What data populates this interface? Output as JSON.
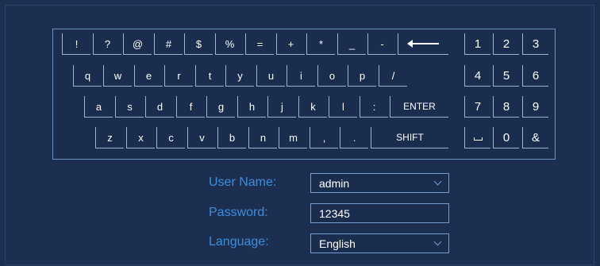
{
  "keyboard": {
    "row1": [
      "!",
      "?",
      "@",
      "#",
      "$",
      "%",
      "=",
      "+",
      "*",
      "_",
      "-"
    ],
    "row2": [
      "q",
      "w",
      "e",
      "r",
      "t",
      "y",
      "u",
      "i",
      "o",
      "p",
      "/"
    ],
    "row3": [
      "a",
      "s",
      "d",
      "f",
      "g",
      "h",
      "j",
      "k",
      "l",
      ":",
      "ENTER"
    ],
    "row4": [
      "z",
      "x",
      "c",
      "v",
      "b",
      "n",
      "m",
      ",",
      ".",
      "SHIFT"
    ],
    "backspace_icon": "left-arrow-icon",
    "numpad": [
      "1",
      "2",
      "3",
      "4",
      "5",
      "6",
      "7",
      "8",
      "9",
      "0",
      "&"
    ],
    "space_icon": "space-bar-icon"
  },
  "form": {
    "username_label": "User Name:",
    "username_value": "admin",
    "password_label": "Password:",
    "password_value": "12345",
    "language_label": "Language:",
    "language_value": "English"
  },
  "colors": {
    "background": "#1d2f50",
    "label": "#3a8fe0",
    "field_border": "#6f9fd6",
    "key_border": "#9fb3d1"
  }
}
